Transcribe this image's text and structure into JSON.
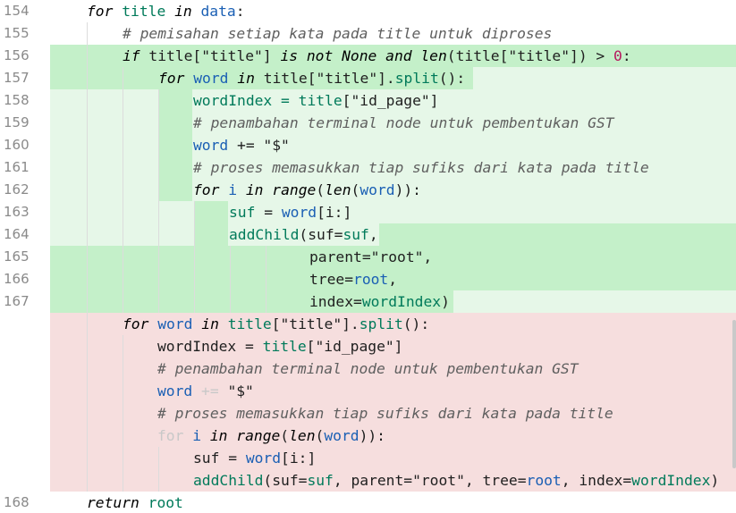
{
  "line_numbers": [
    "154",
    "155",
    "156",
    "157",
    "158",
    "159",
    "160",
    "161",
    "162",
    "163",
    "164",
    "165",
    "166",
    "167",
    "168"
  ],
  "code": {
    "l154": {
      "kw_for": "for",
      "var_title": "title",
      "kw_in": "in",
      "var_data": "data",
      "colon": ":"
    },
    "l155": {
      "comment": "# pemisahan setiap kata pada title untuk diproses"
    },
    "l156": {
      "kw_if": "if",
      "p1": "title[\"title\"]",
      "kw_isnot": "is not",
      "kw_none": "None",
      "kw_and": "and",
      "fn_len": "len",
      "p2": "(title[\"title\"]) > ",
      "zero": "0",
      "colon": ":"
    },
    "l157": {
      "kw_for": "for",
      "var_word": "word",
      "kw_in": "in",
      "p1": "title",
      "p2": "[\"title\"].",
      "split": "split",
      "p3": "():"
    },
    "l158": {
      "p1": "wordIndex = ",
      "p2": "title",
      "p3": "[\"id_page\"]"
    },
    "l159": {
      "comment": "# penambahan terminal node untuk pembentukan GST"
    },
    "l160": {
      "var_word": "word",
      "p1": " += \"$\""
    },
    "l161": {
      "comment": "# proses memasukkan tiap sufiks dari kata pada title"
    },
    "l162": {
      "kw_for": "for",
      "var_i": "i",
      "kw_in": "in",
      "fn_range": "range",
      "fn_len": "len",
      "var_word": "word",
      "p1": "))",
      "colon": ":"
    },
    "l163": {
      "p1": "suf",
      "p2": " = ",
      "var_word": "word",
      "p3": "[i:]"
    },
    "l164": {
      "fn_add": "addChild",
      "p1": "(suf=",
      "var_suf": "suf",
      "p2": ","
    },
    "l165": {
      "p1": "parent=\"root\","
    },
    "l166": {
      "p1": "tree=",
      "var_root": "root",
      "p2": ","
    },
    "l167": {
      "p1": "index=",
      "var_wi": "wordIndex",
      "p2": ")"
    },
    "r1": {
      "kw_for": "for",
      "var_word": "word",
      "kw_in": "in",
      "p1": "title",
      "p2": "[\"title\"].",
      "split": "split",
      "p3": "():"
    },
    "r2": {
      "p1": "wordIndex = ",
      "p2": "title",
      "p3": "[\"id_page\"]"
    },
    "r3": {
      "comment": "# penambahan terminal node untuk pembentukan GST"
    },
    "r4": {
      "var_word": "word",
      "p_faded": "+=",
      "p1": " \"$\""
    },
    "r5": {
      "comment": "# proses memasukkan tiap sufiks dari kata pada title"
    },
    "r6": {
      "kw_for": "for",
      "var_i": "i",
      "kw_in": "in",
      "fn_range": "range",
      "fn_len": "len",
      "var_word": "word",
      "p1": ")):"
    },
    "r7": {
      "p1": "suf = ",
      "var_word": "word",
      "p2": "[i:]"
    },
    "r8": {
      "fn_add": "addChild",
      "p1": "(suf=",
      "var_suf": "suf",
      "p2": ", parent=\"root\", tree=",
      "var_root": "root",
      "p3": ", index=",
      "var_wi": "wordIndex",
      "p4": ")"
    },
    "l168": {
      "kw_return": "return",
      "var_root": "root"
    }
  },
  "colors": {
    "added_light": "#e6f7e8",
    "added_dark": "#c4f0c9",
    "removed": "#f6dede"
  }
}
